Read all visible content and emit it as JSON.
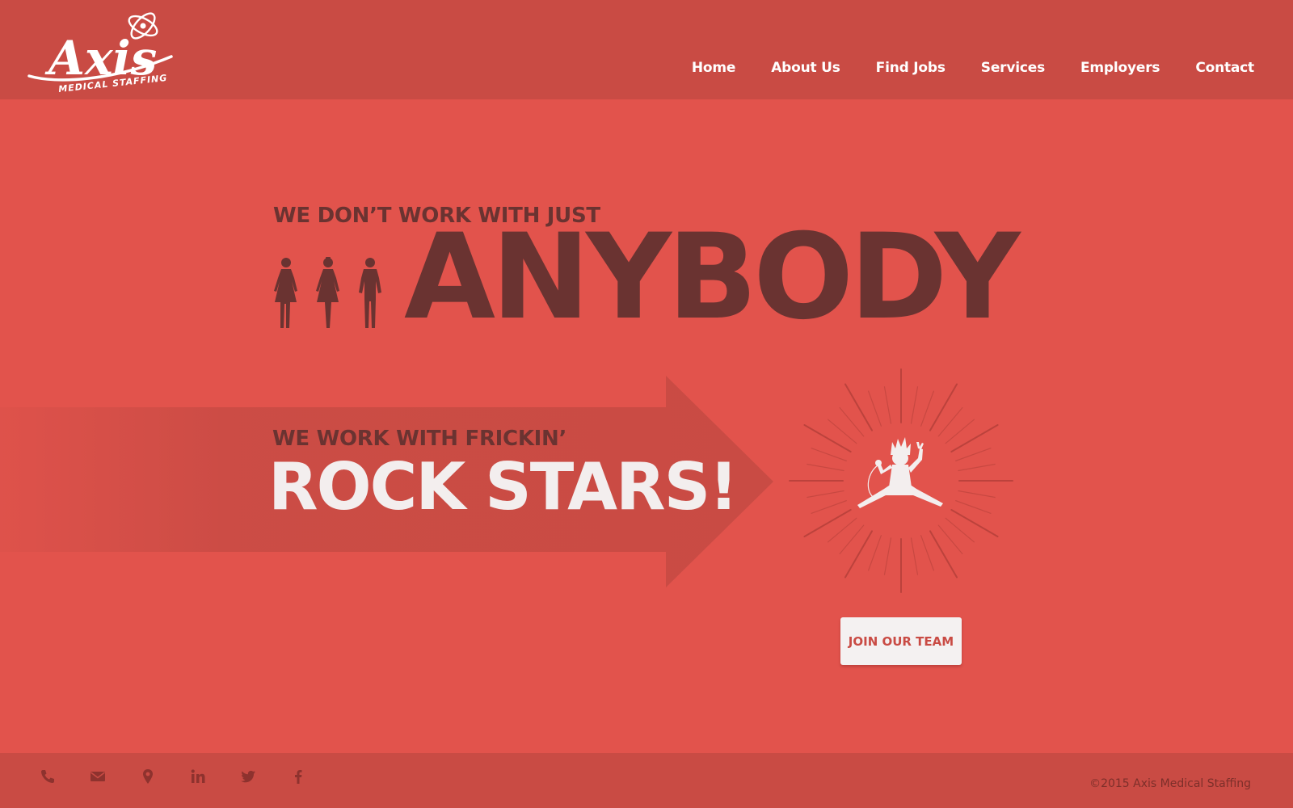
{
  "brand": {
    "logo_text": "Axis",
    "logo_subtext": "MEDICAL STAFFING"
  },
  "nav": {
    "items": [
      "Home",
      "About Us",
      "Find Jobs",
      "Services",
      "Employers",
      "Contact"
    ]
  },
  "hero": {
    "line1": "WE DON’T WORK WITH JUST",
    "line2": "ANYBODY",
    "line3": "WE WORK WITH FRICKIN’",
    "line4": "ROCK STARS!",
    "cta": "JOIN OUR TEAM"
  },
  "footer": {
    "icons": [
      "phone-icon",
      "email-icon",
      "location-pin-icon",
      "linkedin-icon",
      "twitter-icon",
      "facebook-icon"
    ],
    "copyright": "©2015 Axis Medical Staffing"
  },
  "colors": {
    "background": "#e2534c",
    "header": "#c94b44",
    "dark_text": "#6a3331",
    "light_text": "#f3eeee"
  }
}
